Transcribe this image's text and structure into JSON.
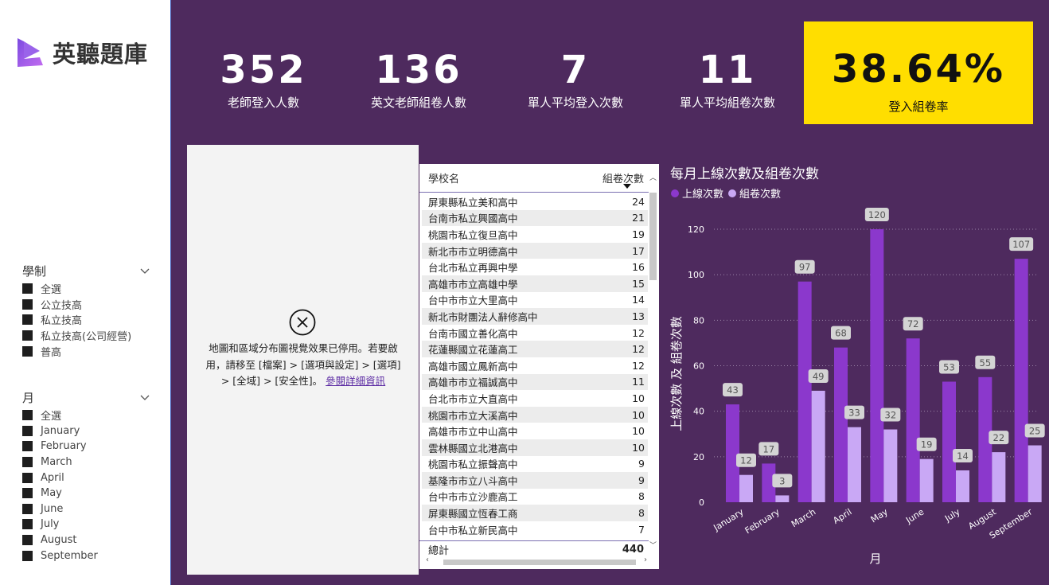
{
  "brand": {
    "name": "英聽題庫"
  },
  "kpis": [
    {
      "value": "352",
      "label": "老師登入人數"
    },
    {
      "value": "136",
      "label": "英文老師組卷人數"
    },
    {
      "value": "7",
      "label": "單人平均登入次數"
    },
    {
      "value": "11",
      "label": "單人平均組卷次數"
    },
    {
      "value": "38.64%",
      "label": "登入組卷率"
    }
  ],
  "colors": {
    "background": "#4e2a5e",
    "highlight": "#ffde00",
    "series_online": "#8b38cc",
    "series_exam": "#c9a8f5"
  },
  "slicers": {
    "school_type": {
      "title": "學制",
      "items": [
        "全選",
        "公立技高",
        "私立技高",
        "私立技高(公司經營)",
        "普高"
      ]
    },
    "month": {
      "title": "月",
      "items": [
        "全選",
        "January",
        "February",
        "March",
        "April",
        "May",
        "June",
        "July",
        "August",
        "September"
      ]
    }
  },
  "map_panel": {
    "icon": "close-circle-icon",
    "message": "地圖和區域分布圖視覺效果已停用。若要啟用，請移至 [檔案] > [選項與設定] > [選項] > [全域] > [安全性]。",
    "link": "參閱詳細資訊"
  },
  "table": {
    "columns": [
      "學校名",
      "組卷次數"
    ],
    "rows": [
      [
        "屏東縣私立美和高中",
        "24"
      ],
      [
        "台南市私立興國高中",
        "21"
      ],
      [
        "桃園市私立復旦高中",
        "19"
      ],
      [
        "新北市市立明德高中",
        "17"
      ],
      [
        "台北市私立再興中學",
        "16"
      ],
      [
        "高雄市市立高雄中學",
        "15"
      ],
      [
        "台中市市立大里高中",
        "14"
      ],
      [
        "新北市財團法人辭修高中",
        "13"
      ],
      [
        "台南市國立善化高中",
        "12"
      ],
      [
        "花蓮縣國立花蓮高工",
        "12"
      ],
      [
        "高雄市國立鳳新高中",
        "12"
      ],
      [
        "高雄市市立福誠高中",
        "11"
      ],
      [
        "台北市市立大直高中",
        "10"
      ],
      [
        "桃園市市立大溪高中",
        "10"
      ],
      [
        "高雄市市立中山高中",
        "10"
      ],
      [
        "雲林縣國立北港高中",
        "10"
      ],
      [
        "桃園市私立振聲高中",
        "9"
      ],
      [
        "基隆市市立八斗高中",
        "9"
      ],
      [
        "台中市市立沙鹿高工",
        "8"
      ],
      [
        "屏東縣國立恆春工商",
        "8"
      ],
      [
        "台中市私立新民高中",
        "7"
      ]
    ],
    "total_label": "總計",
    "total_value": "440"
  },
  "chart_data": {
    "type": "bar",
    "title": "每月上線次數及組卷次數",
    "xlabel": "月",
    "ylabel": "上線次數 及 組卷次數",
    "categories": [
      "January",
      "February",
      "March",
      "April",
      "May",
      "June",
      "July",
      "August",
      "September"
    ],
    "series": [
      {
        "name": "上線次數",
        "values": [
          43,
          17,
          97,
          68,
          120,
          72,
          53,
          55,
          107
        ]
      },
      {
        "name": "組卷次數",
        "values": [
          12,
          3,
          49,
          33,
          32,
          19,
          14,
          22,
          25
        ]
      }
    ],
    "ylim": [
      0,
      120
    ],
    "yticks": [
      0,
      20,
      40,
      60,
      80,
      100,
      120
    ],
    "grid": true,
    "legend": "top-left"
  }
}
